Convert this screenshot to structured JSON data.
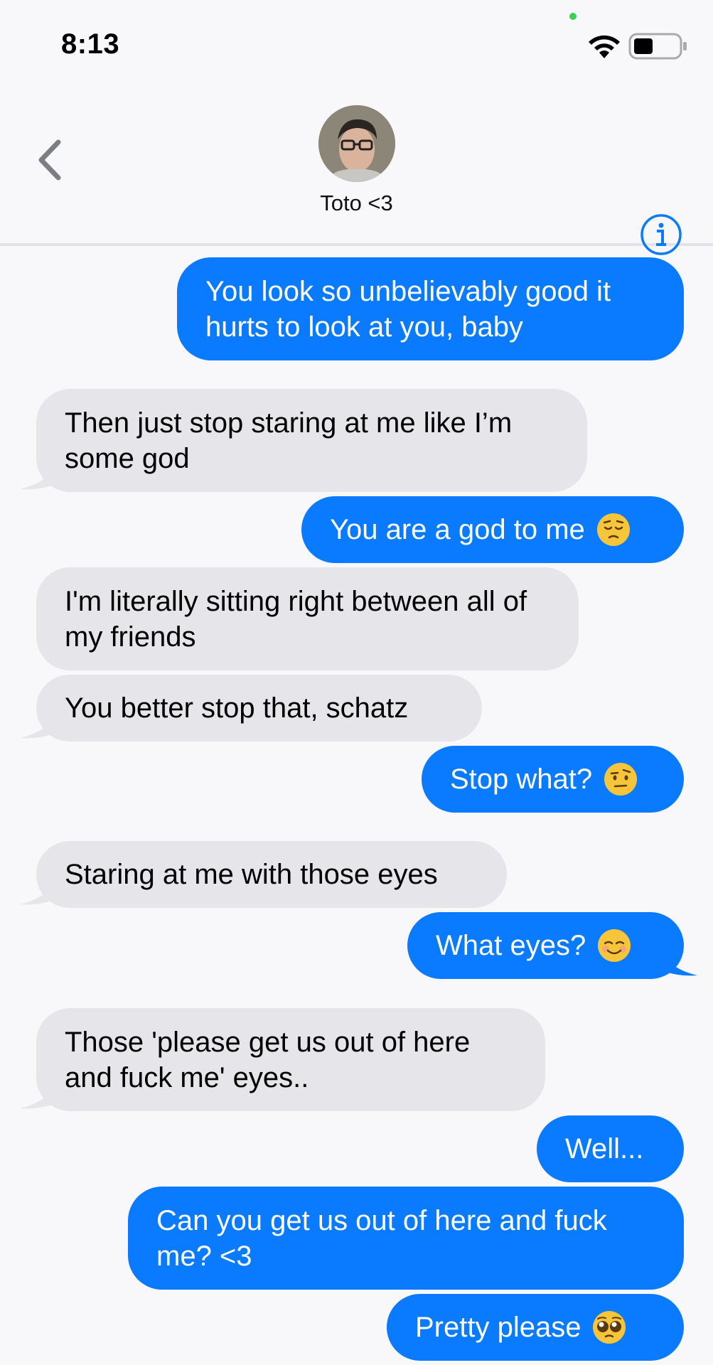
{
  "status_bar": {
    "time": "8:13",
    "wifi_icon": "wifi-icon",
    "battery_icon": "battery-icon"
  },
  "header": {
    "back_icon": "chevron-left-icon",
    "contact_name": "Toto <3",
    "info_icon": "info-icon"
  },
  "colors": {
    "sent_bubble": "#0a7aff",
    "received_bubble": "#e5e5ea",
    "background": "#f8f8fa"
  },
  "messages": [
    {
      "side": "sent",
      "text": "You look so unbelievably good it hurts to look at you, baby"
    },
    {
      "side": "received",
      "text": "Then just stop staring at me like I’m some god"
    },
    {
      "side": "sent",
      "text": "You are a god to me",
      "emoji": "pensive-face"
    },
    {
      "side": "received",
      "text": "I'm literally sitting right between all of my friends"
    },
    {
      "side": "received",
      "text": "You better stop that, schatz"
    },
    {
      "side": "sent",
      "text": "Stop what?",
      "emoji": "raised-eyebrow-face"
    },
    {
      "side": "received",
      "text": "Staring at me with those eyes"
    },
    {
      "side": "sent",
      "text": "What eyes?",
      "emoji": "smiling-face"
    },
    {
      "side": "received",
      "text": "Those 'please get us out of here and fuck me' eyes.."
    },
    {
      "side": "sent",
      "text": "Well..."
    },
    {
      "side": "sent",
      "text": "Can you get us out of here and fuck me? <3"
    },
    {
      "side": "sent",
      "text": "Pretty please",
      "emoji": "pleading-face"
    }
  ]
}
